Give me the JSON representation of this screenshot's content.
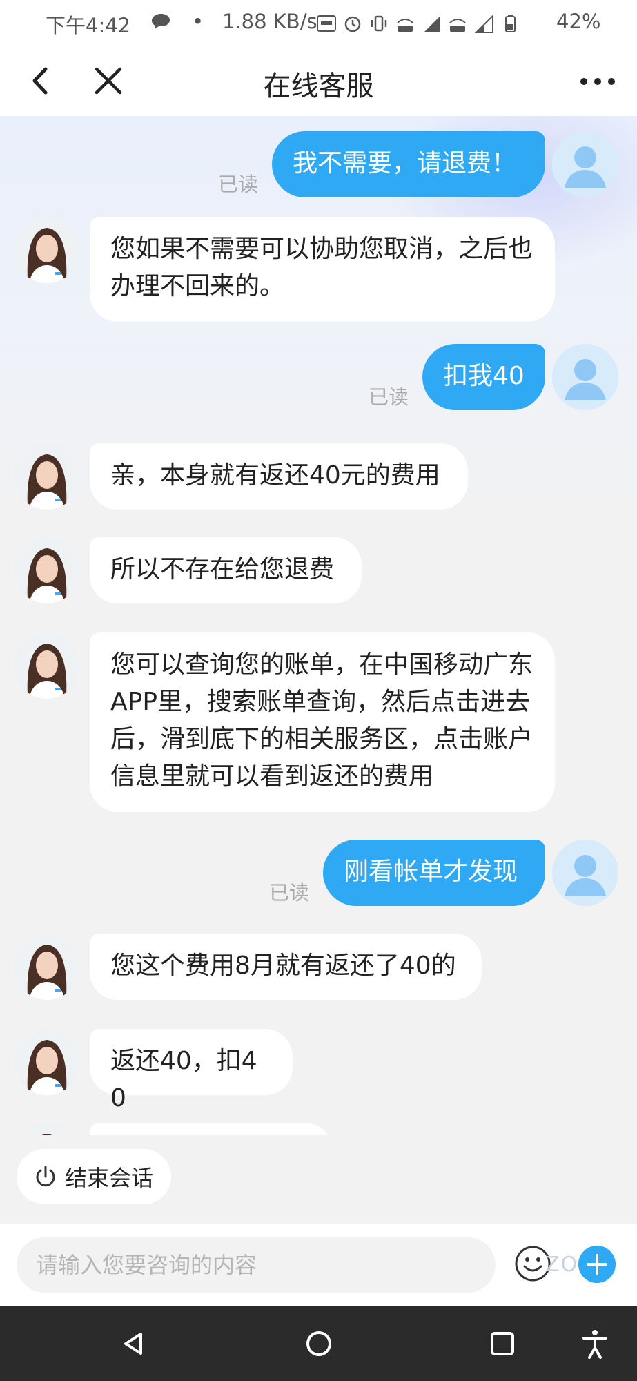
{
  "status_bar": {
    "time": "下午4:42",
    "dot": "•",
    "network_speed": "1.88 KB/s",
    "battery": "42%"
  },
  "nav": {
    "title": "在线客服"
  },
  "messages": [
    {
      "sender": "user",
      "text": "我不需要，请退费！",
      "status": "已读"
    },
    {
      "sender": "agent",
      "text": "您如果不需要可以协助您取消，之后也办理不回来的。"
    },
    {
      "sender": "user",
      "text": "扣我40",
      "status": "已读"
    },
    {
      "sender": "agent",
      "text": "亲，本身就有返还40元的费用"
    },
    {
      "sender": "agent",
      "text": "所以不存在给您退费"
    },
    {
      "sender": "agent",
      "text": "您可以查询您的账单，在中国移动广东APP里，搜索账单查询，然后点击进去后，滑到底下的相关服务区，点击账户信息里就可以看到返还的费用"
    },
    {
      "sender": "user",
      "text": "刚看帐单才发现",
      "status": "已读"
    },
    {
      "sender": "agent",
      "text": "您这个费用8月就有返还了40的"
    },
    {
      "sender": "agent",
      "text": "返还40，扣40"
    }
  ],
  "end_session": {
    "label": "结束会话"
  },
  "input": {
    "placeholder": "请输入您要咨询的内容"
  },
  "watermark": "ZOL",
  "colors": {
    "accent": "#2fa9f3",
    "agent_bubble": "#ffffff",
    "background": "#f2f2f2",
    "read_label": "#aaaaaa"
  },
  "icons": {
    "nav_back": "chevron-left-icon",
    "nav_close": "close-icon",
    "nav_more": "more-dots-icon",
    "end_session": "power-icon",
    "emoji": "emoji-icon",
    "add": "plus-icon",
    "sys_back": "triangle-back-icon",
    "sys_home": "circle-home-icon",
    "sys_recents": "square-recents-icon",
    "sys_accessibility": "accessibility-icon"
  }
}
